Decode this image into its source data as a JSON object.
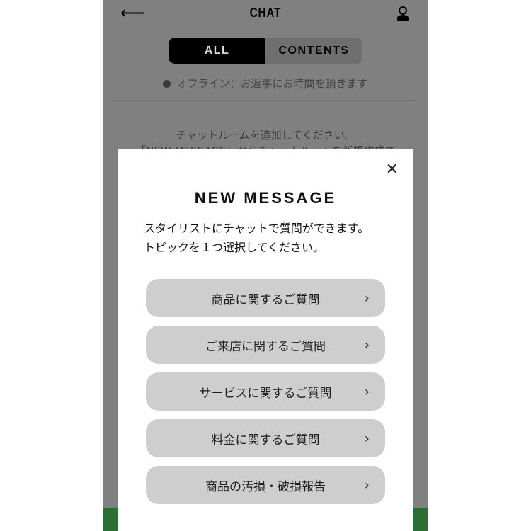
{
  "header": {
    "title": "CHAT",
    "back_icon": "arrow-left-icon",
    "user_icon": "user-icon"
  },
  "tabs": [
    {
      "label": "ALL",
      "active": true
    },
    {
      "label": "CONTENTS",
      "active": false
    }
  ],
  "status": "オフライン：お返事にお時間を頂きます",
  "empty": {
    "line1": "チャットルームを追加してください。",
    "line2": "「NEW MESSAGE」からチャットルームを新規作成で"
  },
  "modal": {
    "title": "NEW MESSAGE",
    "desc1": "スタイリストにチャットで質問ができます。",
    "desc2": "トピックを１つ選択してください。",
    "options": [
      "商品に関するご質問",
      "ご来店に関するご質問",
      "サービスに関するご質問",
      "料金に関するご質問",
      "商品の汚損・破損報告"
    ]
  },
  "colors": {
    "overlay": "#808080",
    "button": "#cecece",
    "green": "#2b6e36"
  }
}
